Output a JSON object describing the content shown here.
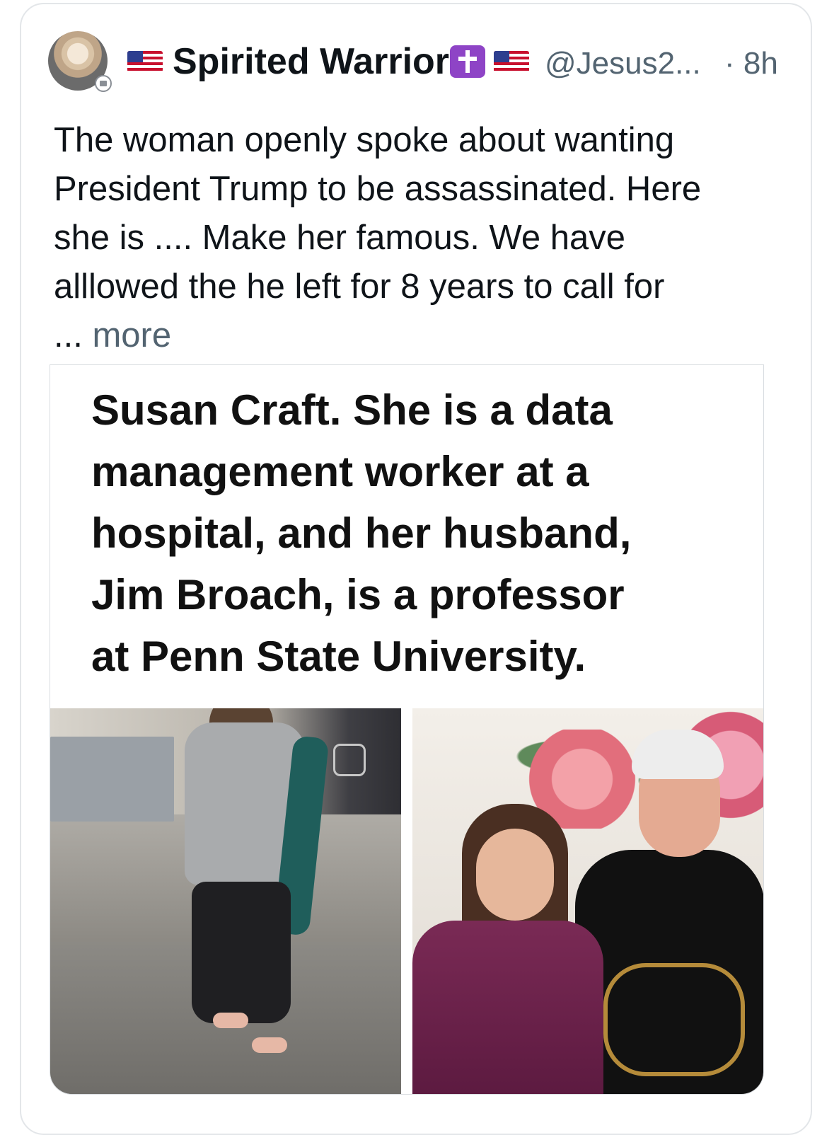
{
  "tweet": {
    "display_name": "Spirited Warrior",
    "handle": "@Jesus2...",
    "time": "· 8h",
    "text_lines": [
      "The woman openly spoke about wanting",
      "President Trump to be assassinated. Here",
      "she is .... Make her famous. We have",
      "alllowed the he left for 8 years to call for"
    ],
    "ellipsis": "...",
    "more_label": "more"
  },
  "media": {
    "caption_lines": [
      "Susan Craft. She is a data",
      "management worker at a",
      "hospital, and her husband,",
      "Jim Broach, is a professor",
      "at Penn State University."
    ]
  },
  "icons": {
    "flag": "us-flag-icon",
    "badge": "latin-cross-icon",
    "verified": "affiliate-badge-icon"
  },
  "colors": {
    "text_primary": "#0f1419",
    "text_secondary": "#536471",
    "border": "#e3e6e9",
    "cross_badge": "#8e44c6"
  }
}
